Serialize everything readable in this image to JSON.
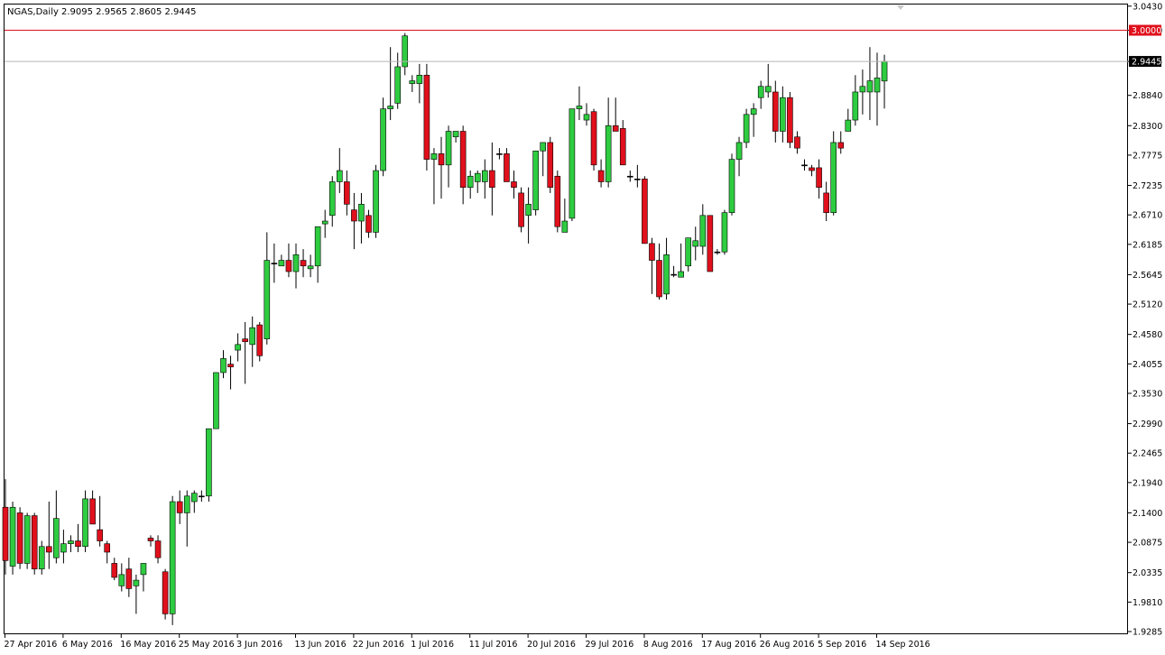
{
  "window": {
    "symbol_timeframe": "NGAS,Daily",
    "ohlc_readout": "2.9095 2.9565 2.8605 2.9445"
  },
  "colors": {
    "bull": "#2ecc40",
    "bear": "#e0101c",
    "wick": "#000000",
    "price_line": "#b4b4b4",
    "level_line": "#e0101c",
    "frame": "#000000"
  },
  "chart_data": {
    "type": "candlestick",
    "title": "",
    "xlabel": "",
    "ylabel": "",
    "ylim": [
      1.9285,
      3.043
    ],
    "grid": false,
    "y_ticks": [
      "3.0430",
      "3.0000",
      "2.9445",
      "2.8840",
      "2.8300",
      "2.7775",
      "2.7235",
      "2.6710",
      "2.6185",
      "2.5645",
      "2.5120",
      "2.4580",
      "2.4055",
      "2.3530",
      "2.2990",
      "2.2465",
      "2.1940",
      "2.1400",
      "2.0875",
      "2.0335",
      "1.9810",
      "1.9285"
    ],
    "x_ticks": [
      {
        "index": 0,
        "label": "27 Apr 2016"
      },
      {
        "index": 8,
        "label": "6 May 2016"
      },
      {
        "index": 16,
        "label": "16 May 2016"
      },
      {
        "index": 24,
        "label": "25 May 2016"
      },
      {
        "index": 32,
        "label": "3 Jun 2016"
      },
      {
        "index": 40,
        "label": "13 Jun 2016"
      },
      {
        "index": 48,
        "label": "22 Jun 2016"
      },
      {
        "index": 56,
        "label": "1 Jul 2016"
      },
      {
        "index": 64,
        "label": "11 Jul 2016"
      },
      {
        "index": 72,
        "label": "20 Jul 2016"
      },
      {
        "index": 80,
        "label": "29 Jul 2016"
      },
      {
        "index": 88,
        "label": "8 Aug 2016"
      },
      {
        "index": 96,
        "label": "17 Aug 2016"
      },
      {
        "index": 104,
        "label": "26 Aug 2016"
      },
      {
        "index": 112,
        "label": "5 Sep 2016"
      },
      {
        "index": 120,
        "label": "14 Sep 2016"
      }
    ],
    "horizontal_level": {
      "value": 3.0,
      "label": "3.0000"
    },
    "current_price": {
      "value": 2.9445,
      "label": "2.9445"
    },
    "candles": [
      [
        2.15,
        2.2,
        2.03,
        2.055
      ],
      [
        2.045,
        2.16,
        2.03,
        2.15
      ],
      [
        2.14,
        2.15,
        2.04,
        2.05
      ],
      [
        2.05,
        2.14,
        2.04,
        2.135
      ],
      [
        2.135,
        2.14,
        2.03,
        2.04
      ],
      [
        2.04,
        2.09,
        2.03,
        2.08
      ],
      [
        2.08,
        2.16,
        2.04,
        2.07
      ],
      [
        2.06,
        2.18,
        2.05,
        2.13
      ],
      [
        2.07,
        2.11,
        2.05,
        2.085
      ],
      [
        2.085,
        2.1,
        2.07,
        2.09
      ],
      [
        2.09,
        2.12,
        2.07,
        2.08
      ],
      [
        2.08,
        2.18,
        2.07,
        2.165
      ],
      [
        2.165,
        2.18,
        2.12,
        2.12
      ],
      [
        2.11,
        2.17,
        2.08,
        2.09
      ],
      [
        2.085,
        2.09,
        2.05,
        2.07
      ],
      [
        2.05,
        2.06,
        2.02,
        2.025
      ],
      [
        2.01,
        2.05,
        2.0,
        2.03
      ],
      [
        2.04,
        2.06,
        1.99,
        2.005
      ],
      [
        2.01,
        2.03,
        1.96,
        2.02
      ],
      [
        2.03,
        2.05,
        2.0,
        2.05
      ],
      [
        2.095,
        2.1,
        2.08,
        2.09
      ],
      [
        2.09,
        2.1,
        2.05,
        2.06
      ],
      [
        2.035,
        2.04,
        1.95,
        1.96
      ],
      [
        1.96,
        2.17,
        1.94,
        2.16
      ],
      [
        2.16,
        2.18,
        2.12,
        2.14
      ],
      [
        2.14,
        2.18,
        2.08,
        2.17
      ],
      [
        2.16,
        2.18,
        2.14,
        2.175
      ],
      [
        2.17,
        2.18,
        2.16,
        2.17
      ],
      [
        2.17,
        2.29,
        2.16,
        2.29
      ],
      [
        2.29,
        2.39,
        2.29,
        2.39
      ],
      [
        2.39,
        2.43,
        2.38,
        2.415
      ],
      [
        2.405,
        2.42,
        2.36,
        2.4
      ],
      [
        2.43,
        2.46,
        2.41,
        2.44
      ],
      [
        2.45,
        2.48,
        2.37,
        2.445
      ],
      [
        2.44,
        2.49,
        2.4,
        2.47
      ],
      [
        2.475,
        2.48,
        2.41,
        2.42
      ],
      [
        2.45,
        2.64,
        2.44,
        2.59
      ],
      [
        2.585,
        2.62,
        2.55,
        2.585
      ],
      [
        2.58,
        2.6,
        2.58,
        2.59
      ],
      [
        2.59,
        2.62,
        2.56,
        2.57
      ],
      [
        2.57,
        2.62,
        2.54,
        2.6
      ],
      [
        2.59,
        2.61,
        2.56,
        2.58
      ],
      [
        2.575,
        2.6,
        2.56,
        2.58
      ],
      [
        2.58,
        2.65,
        2.55,
        2.65
      ],
      [
        2.655,
        2.68,
        2.63,
        2.66
      ],
      [
        2.67,
        2.74,
        2.65,
        2.73
      ],
      [
        2.73,
        2.79,
        2.71,
        2.75
      ],
      [
        2.73,
        2.75,
        2.67,
        2.69
      ],
      [
        2.68,
        2.71,
        2.61,
        2.66
      ],
      [
        2.66,
        2.71,
        2.62,
        2.69
      ],
      [
        2.67,
        2.68,
        2.63,
        2.64
      ],
      [
        2.64,
        2.76,
        2.63,
        2.75
      ],
      [
        2.75,
        2.88,
        2.74,
        2.86
      ],
      [
        2.86,
        2.97,
        2.84,
        2.865
      ],
      [
        2.87,
        2.96,
        2.86,
        2.935
      ],
      [
        2.935,
        2.995,
        2.92,
        2.99
      ],
      [
        2.905,
        2.92,
        2.89,
        2.91
      ],
      [
        2.905,
        2.94,
        2.87,
        2.92
      ],
      [
        2.92,
        2.94,
        2.75,
        2.77
      ],
      [
        2.77,
        2.79,
        2.69,
        2.78
      ],
      [
        2.78,
        2.81,
        2.7,
        2.76
      ],
      [
        2.76,
        2.83,
        2.72,
        2.82
      ],
      [
        2.81,
        2.82,
        2.8,
        2.82
      ],
      [
        2.82,
        2.83,
        2.69,
        2.72
      ],
      [
        2.72,
        2.75,
        2.7,
        2.74
      ],
      [
        2.73,
        2.75,
        2.71,
        2.745
      ],
      [
        2.73,
        2.77,
        2.7,
        2.75
      ],
      [
        2.75,
        2.8,
        2.67,
        2.72
      ],
      [
        2.78,
        2.79,
        2.77,
        2.78
      ],
      [
        2.78,
        2.79,
        2.73,
        2.73
      ],
      [
        2.73,
        2.75,
        2.7,
        2.72
      ],
      [
        2.71,
        2.72,
        2.64,
        2.65
      ],
      [
        2.67,
        2.72,
        2.62,
        2.69
      ],
      [
        2.68,
        2.78,
        2.67,
        2.785
      ],
      [
        2.785,
        2.8,
        2.74,
        2.8
      ],
      [
        2.8,
        2.81,
        2.71,
        2.72
      ],
      [
        2.74,
        2.75,
        2.64,
        2.65
      ],
      [
        2.64,
        2.7,
        2.64,
        2.66
      ],
      [
        2.665,
        2.86,
        2.66,
        2.86
      ],
      [
        2.86,
        2.9,
        2.84,
        2.865
      ],
      [
        2.84,
        2.87,
        2.83,
        2.85
      ],
      [
        2.855,
        2.86,
        2.75,
        2.76
      ],
      [
        2.75,
        2.77,
        2.72,
        2.73
      ],
      [
        2.73,
        2.88,
        2.72,
        2.83
      ],
      [
        2.83,
        2.88,
        2.82,
        2.82
      ],
      [
        2.825,
        2.84,
        2.76,
        2.76
      ],
      [
        2.74,
        2.75,
        2.73,
        2.74
      ],
      [
        2.735,
        2.76,
        2.72,
        2.735
      ],
      [
        2.735,
        2.74,
        2.62,
        2.62
      ],
      [
        2.62,
        2.63,
        2.53,
        2.59
      ],
      [
        2.59,
        2.62,
        2.52,
        2.525
      ],
      [
        2.53,
        2.63,
        2.52,
        2.6
      ],
      [
        2.565,
        2.58,
        2.56,
        2.565
      ],
      [
        2.56,
        2.62,
        2.56,
        2.57
      ],
      [
        2.58,
        2.63,
        2.57,
        2.63
      ],
      [
        2.615,
        2.65,
        2.59,
        2.625
      ],
      [
        2.615,
        2.69,
        2.6,
        2.67
      ],
      [
        2.67,
        2.67,
        2.57,
        2.57
      ],
      [
        2.605,
        2.61,
        2.6,
        2.605
      ],
      [
        2.605,
        2.68,
        2.6,
        2.675
      ],
      [
        2.675,
        2.78,
        2.67,
        2.77
      ],
      [
        2.77,
        2.81,
        2.74,
        2.8
      ],
      [
        2.8,
        2.86,
        2.79,
        2.85
      ],
      [
        2.85,
        2.87,
        2.81,
        2.86
      ],
      [
        2.88,
        2.91,
        2.86,
        2.9
      ],
      [
        2.89,
        2.94,
        2.88,
        2.9
      ],
      [
        2.89,
        2.91,
        2.8,
        2.82
      ],
      [
        2.82,
        2.9,
        2.8,
        2.88
      ],
      [
        2.88,
        2.89,
        2.79,
        2.8
      ],
      [
        2.81,
        2.82,
        2.78,
        2.79
      ],
      [
        2.76,
        2.77,
        2.75,
        2.76
      ],
      [
        2.755,
        2.76,
        2.74,
        2.75
      ],
      [
        2.755,
        2.77,
        2.7,
        2.72
      ],
      [
        2.71,
        2.73,
        2.66,
        2.675
      ],
      [
        2.675,
        2.82,
        2.67,
        2.8
      ],
      [
        2.8,
        2.82,
        2.78,
        2.79
      ],
      [
        2.82,
        2.86,
        2.82,
        2.84
      ],
      [
        2.84,
        2.92,
        2.83,
        2.89
      ],
      [
        2.89,
        2.93,
        2.85,
        2.9
      ],
      [
        2.89,
        2.97,
        2.84,
        2.91
      ],
      [
        2.89,
        2.96,
        2.83,
        2.915
      ],
      [
        2.9095,
        2.9565,
        2.8605,
        2.9445
      ]
    ]
  }
}
